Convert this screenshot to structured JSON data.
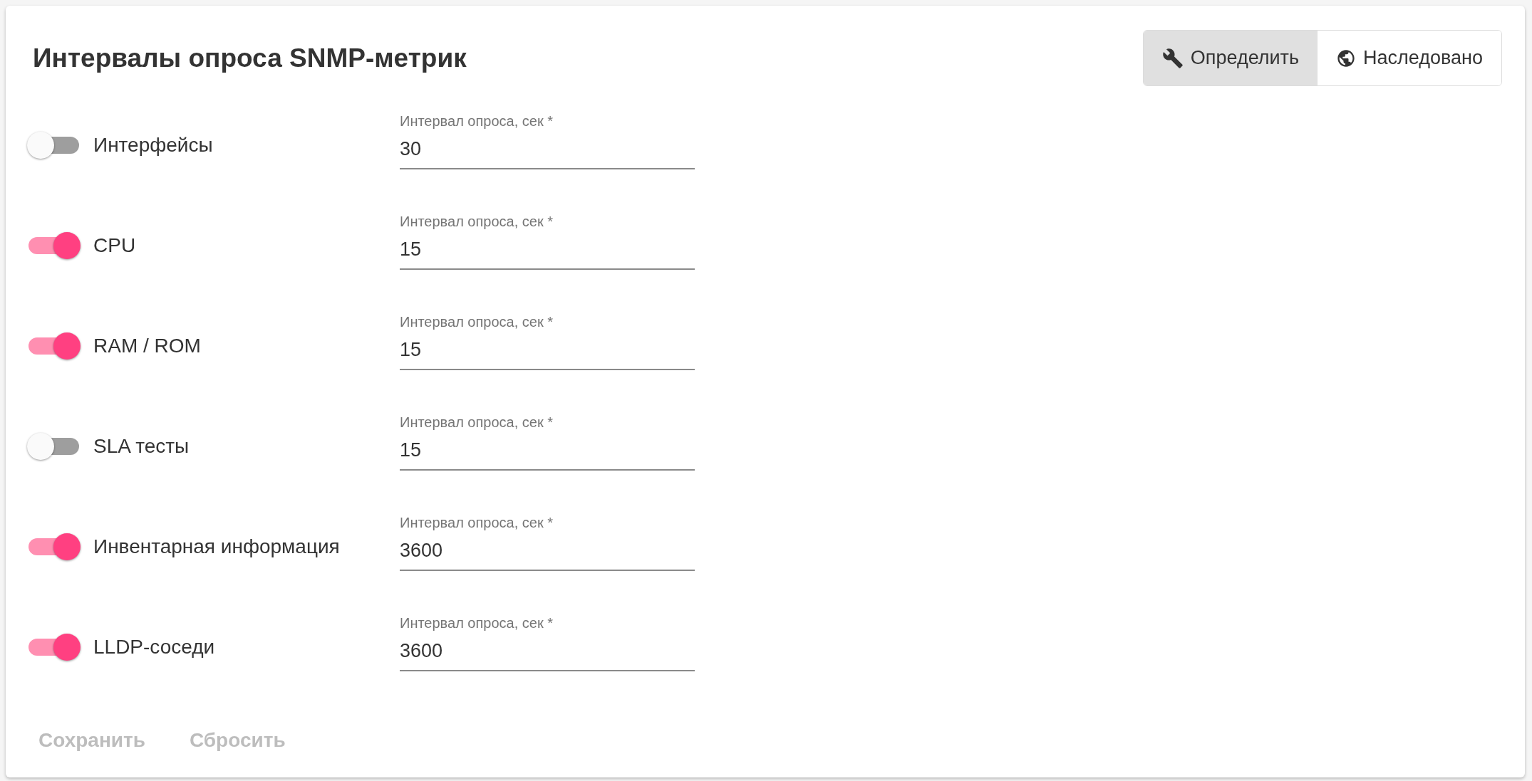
{
  "title": "Интервалы опроса SNMP-метрик",
  "mode_toggle": [
    {
      "kind": "wrench",
      "label": "Определить",
      "selected": true
    },
    {
      "kind": "globe",
      "label": "Наследовано",
      "selected": false
    }
  ],
  "metrics": [
    {
      "name": "Интерфейсы",
      "on": false,
      "field_label": "Интервал опроса, сек *",
      "value": "30"
    },
    {
      "name": "CPU",
      "on": true,
      "field_label": "Интервал опроса, сек *",
      "value": "15"
    },
    {
      "name": "RAM / ROM",
      "on": true,
      "field_label": "Интервал опроса, сек *",
      "value": "15"
    },
    {
      "name": "SLA тесты",
      "on": false,
      "field_label": "Интервал опроса, сек *",
      "value": "15"
    },
    {
      "name": "Инвентарная информация",
      "on": true,
      "field_label": "Интервал опроса, сек *",
      "value": "3600"
    },
    {
      "name": "LLDP-соседи",
      "on": true,
      "field_label": "Интервал опроса, сек *",
      "value": "3600"
    }
  ],
  "actions": [
    {
      "label": "Сохранить",
      "disabled": true
    },
    {
      "label": "Сбросить",
      "disabled": true
    }
  ]
}
